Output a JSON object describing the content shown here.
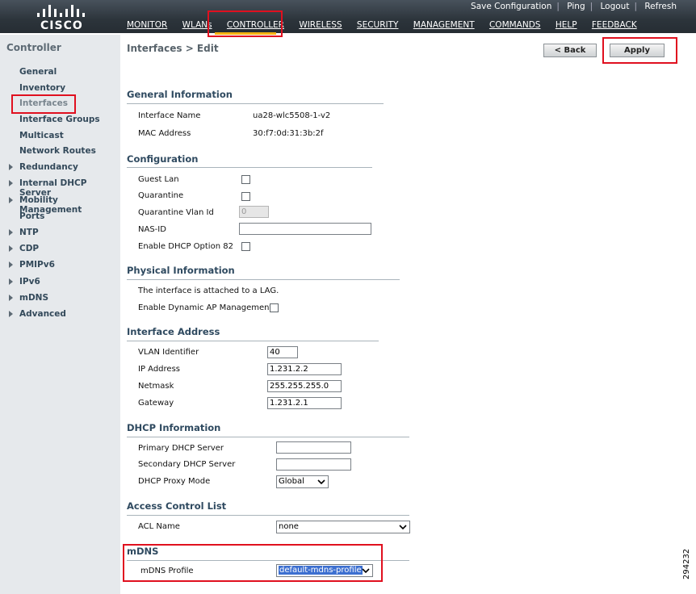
{
  "header": {
    "brand": "CISCO",
    "util_links": [
      "Save Configuration",
      "Ping",
      "Logout",
      "Refresh"
    ],
    "nav": [
      "MONITOR",
      "WLANs",
      "CONTROLLER",
      "WIRELESS",
      "SECURITY",
      "MANAGEMENT",
      "COMMANDS",
      "HELP",
      "FEEDBACK"
    ],
    "active_nav": "CONTROLLER",
    "accent_color": "#f6b210"
  },
  "sidebar": {
    "title": "Controller",
    "items": [
      {
        "label": "General"
      },
      {
        "label": "Inventory"
      },
      {
        "label": "Interfaces"
      },
      {
        "label": "Interface Groups"
      },
      {
        "label": "Multicast"
      },
      {
        "label": "Network Routes"
      },
      {
        "label": "Redundancy"
      },
      {
        "label": "Internal DHCP Server"
      },
      {
        "label": "Mobility Management"
      },
      {
        "label": "Ports"
      },
      {
        "label": "NTP"
      },
      {
        "label": "CDP"
      },
      {
        "label": "PMIPv6"
      },
      {
        "label": "IPv6"
      },
      {
        "label": "mDNS"
      },
      {
        "label": "Advanced"
      }
    ]
  },
  "page": {
    "title": "Interfaces > Edit",
    "back_label": "< Back",
    "apply_label": "Apply"
  },
  "general": {
    "heading": "General Information",
    "interface_name_label": "Interface Name",
    "interface_name": "ua28-wlc5508-1-v2",
    "mac_label": "MAC Address",
    "mac": "30:f7:0d:31:3b:2f"
  },
  "configuration": {
    "heading": "Configuration",
    "guest_lan_label": "Guest Lan",
    "quarantine_label": "Quarantine",
    "quarantine_vlan_label": "Quarantine Vlan Id",
    "quarantine_vlan_value": "0",
    "nas_id_label": "NAS-ID",
    "nas_id_value": "",
    "dhcp82_label": "Enable DHCP Option 82"
  },
  "physical": {
    "heading": "Physical Information",
    "lag_text": "The interface is attached to a LAG.",
    "dyn_ap_label": "Enable Dynamic AP Management"
  },
  "address": {
    "heading": "Interface Address",
    "vlan_label": "VLAN Identifier",
    "vlan": "40",
    "ip_label": "IP Address",
    "ip": "1.231.2.2",
    "netmask_label": "Netmask",
    "netmask": "255.255.255.0",
    "gateway_label": "Gateway",
    "gateway": "1.231.2.1"
  },
  "dhcp": {
    "heading": "DHCP Information",
    "primary_label": "Primary DHCP Server",
    "primary": "",
    "secondary_label": "Secondary DHCP Server",
    "secondary": "",
    "proxy_label": "DHCP Proxy Mode",
    "proxy": "Global"
  },
  "acl": {
    "heading": "Access Control List",
    "name_label": "ACL Name",
    "name": "none"
  },
  "mdns": {
    "heading": "mDNS",
    "profile_label": "mDNS Profile",
    "profile": "default-mdns-profile"
  },
  "figure_id": "294232"
}
